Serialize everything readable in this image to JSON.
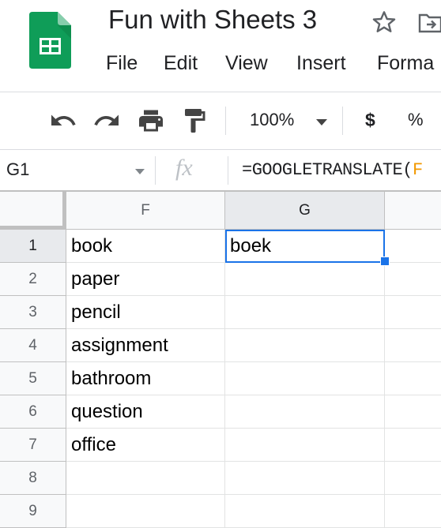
{
  "app": {
    "title": "Fun with Sheets 3",
    "menu": [
      "File",
      "Edit",
      "View",
      "Insert",
      "Forma"
    ]
  },
  "toolbar": {
    "undo_icon": "undo-icon",
    "redo_icon": "redo-icon",
    "print_icon": "print-icon",
    "paint_format_icon": "paint-format-icon",
    "zoom": "100%",
    "currency": "$",
    "percent": "%"
  },
  "formula_bar": {
    "name_box": "G1",
    "fx": "fx",
    "formula_main": "=GOOGLETRANSLATE(",
    "formula_tail": "F"
  },
  "grid": {
    "columns": [
      "F",
      "G"
    ],
    "rows": [
      "1",
      "2",
      "3",
      "4",
      "5",
      "6",
      "7",
      "8",
      "9"
    ],
    "col_f": [
      "book",
      "paper",
      "pencil",
      "assignment",
      "bathroom",
      "question",
      "office",
      "",
      ""
    ],
    "col_g": [
      "boek",
      "",
      "",
      "",
      "",
      "",
      "",
      "",
      ""
    ],
    "active_cell": "G1"
  },
  "colors": {
    "logo_green": "#0f9d58",
    "selection_blue": "#1a73e8",
    "formula_ref_orange": "#f29900"
  }
}
